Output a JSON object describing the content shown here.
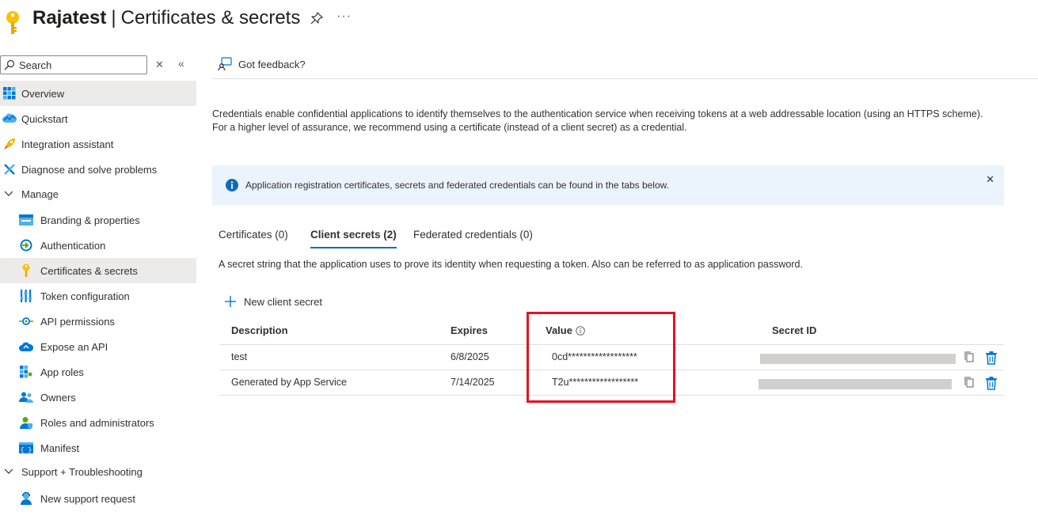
{
  "header": {
    "app_name": "Rajatest",
    "separator": "|",
    "page_title": "Certificates & secrets",
    "more": "···"
  },
  "sidebar": {
    "search_placeholder": "Search",
    "clear_glyph": "✕",
    "collapse_glyph": "«",
    "items": [
      {
        "label": "Overview",
        "icon": "overview-icon"
      },
      {
        "label": "Quickstart",
        "icon": "quickstart-icon"
      },
      {
        "label": "Integration assistant",
        "icon": "rocket-icon"
      },
      {
        "label": "Diagnose and solve problems",
        "icon": "wrench-icon"
      },
      {
        "label": "Manage",
        "icon": "chevron-down-icon"
      },
      {
        "label": "Branding & properties",
        "icon": "branding-icon"
      },
      {
        "label": "Authentication",
        "icon": "authentication-icon"
      },
      {
        "label": "Certificates & secrets",
        "icon": "key-icon"
      },
      {
        "label": "Token configuration",
        "icon": "token-icon"
      },
      {
        "label": "API permissions",
        "icon": "api-permissions-icon"
      },
      {
        "label": "Expose an API",
        "icon": "cloud-icon"
      },
      {
        "label": "App roles",
        "icon": "app-roles-icon"
      },
      {
        "label": "Owners",
        "icon": "owners-icon"
      },
      {
        "label": "Roles and administrators",
        "icon": "roles-icon"
      },
      {
        "label": "Manifest",
        "icon": "manifest-icon"
      },
      {
        "label": "Support + Troubleshooting",
        "icon": "chevron-down-icon"
      },
      {
        "label": "New support request",
        "icon": "support-icon"
      }
    ]
  },
  "toolbar": {
    "feedback_label": "Got feedback?"
  },
  "main": {
    "description": "Credentials enable confidential applications to identify themselves to the authentication service when receiving tokens at a web addressable location (using an HTTPS scheme). For a higher level of assurance, we recommend using a certificate (instead of a client secret) as a credential.",
    "info_banner": "Application registration certificates, secrets and federated credentials can be found in the tabs below.",
    "info_close": "✕",
    "tabs": [
      {
        "label": "Certificates (0)"
      },
      {
        "label": "Client secrets (2)"
      },
      {
        "label": "Federated credentials (0)"
      }
    ],
    "tab_description": "A secret string that the application uses to prove its identity when requesting a token. Also can be referred to as application password.",
    "new_secret_label": "New client secret",
    "table": {
      "headers": [
        "Description",
        "Expires",
        "Value",
        "Secret ID"
      ],
      "rows": [
        {
          "description": "test",
          "expires": "6/8/2025",
          "value": "0cd******************"
        },
        {
          "description": "Generated by App Service",
          "expires": "7/14/2025",
          "value": "T2u******************"
        }
      ]
    }
  },
  "colors": {
    "accent": "#0f6cbd",
    "highlight_border": "#e81123",
    "info_background": "#ebf3fc",
    "selected_nav": "#edebe9"
  }
}
